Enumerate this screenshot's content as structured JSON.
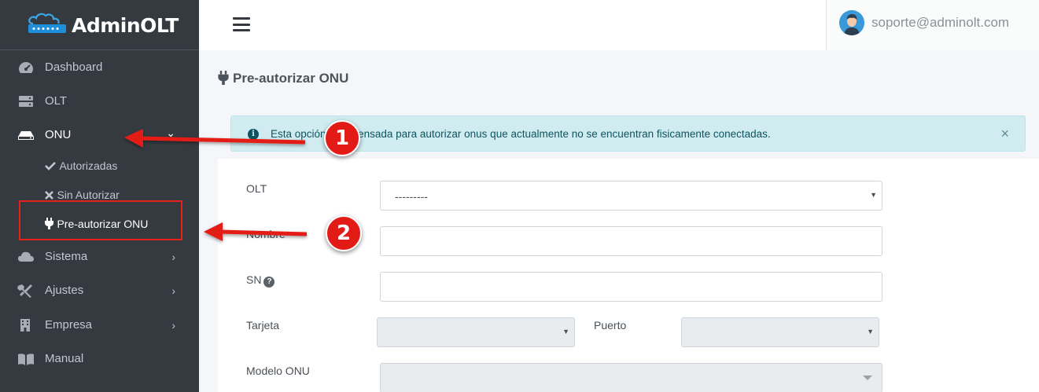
{
  "brand": {
    "name": "AdminOLT",
    "logo_icon": "router-cloud-icon"
  },
  "header": {
    "menu_icon": "hamburger-icon",
    "user_email": "soporte@adminolt.com"
  },
  "sidebar": {
    "items": [
      {
        "label": "Dashboard",
        "icon": "tachometer-icon"
      },
      {
        "label": "OLT",
        "icon": "server-icon"
      },
      {
        "label": "ONU",
        "icon": "hdd-icon",
        "chevron": "⌄"
      },
      {
        "label": "Sistema",
        "icon": "cloud-icon",
        "chevron": "›"
      },
      {
        "label": "Ajustes",
        "icon": "tools-icon",
        "chevron": "›"
      },
      {
        "label": "Empresa",
        "icon": "building-icon",
        "chevron": "›"
      },
      {
        "label": "Manual",
        "icon": "book-icon"
      }
    ],
    "subitems": [
      {
        "label": "Autorizadas",
        "icon": "check-icon"
      },
      {
        "label": "Sin Autorizar",
        "icon": "times-icon"
      },
      {
        "label": "Pre-autorizar ONU",
        "icon": "plug-icon"
      }
    ]
  },
  "page": {
    "title": "Pre-autorizar ONU",
    "title_icon": "plug-icon"
  },
  "alert": {
    "text": "Esta opción está pensada para autorizar onus que actualmente no se encuentran fisicamente conectadas.",
    "icon": "info-circle-icon",
    "close": "×"
  },
  "form": {
    "olt": {
      "label": "OLT",
      "value": "---------"
    },
    "nombre": {
      "label": "Nombre",
      "value": ""
    },
    "sn": {
      "label": "SN",
      "value": ""
    },
    "tarjeta": {
      "label": "Tarjeta",
      "value": ""
    },
    "puerto": {
      "label": "Puerto",
      "value": ""
    },
    "modelo": {
      "label": "Modelo ONU",
      "value": ""
    }
  },
  "callouts": [
    {
      "number": "1"
    },
    {
      "number": "2"
    }
  ],
  "colors": {
    "sidebar_bg": "#343a40",
    "alert_bg": "#d1ecf1",
    "callout_red": "#e31b17"
  }
}
